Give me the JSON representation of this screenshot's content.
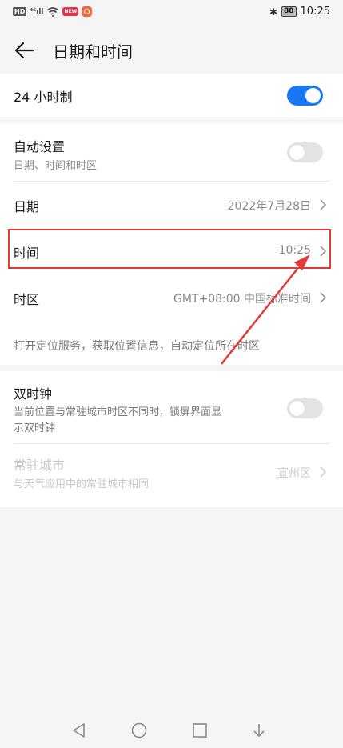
{
  "status_bar": {
    "hd": "HD",
    "signal": "⁴⁶ıll",
    "red_badge": "NEW",
    "time": "10:25",
    "battery": "88"
  },
  "header": {
    "title": "日期和时间"
  },
  "rows": {
    "hour24": {
      "label": "24 小时制",
      "enabled": true
    },
    "auto": {
      "label": "自动设置",
      "sub": "日期、时间和时区",
      "enabled": false
    },
    "date": {
      "label": "日期",
      "value": "2022年7月28日"
    },
    "time": {
      "label": "时间",
      "value": "10:25"
    },
    "zone": {
      "label": "时区",
      "value": "GMT+08:00 中国标准时间"
    },
    "zone_hint": "打开定位服务，获取位置信息，自动定位所在时区",
    "dual": {
      "label": "双时钟",
      "sub_line1": "当前位置与常驻城市时区不同时，锁屏界面显",
      "sub_line2": "示双时钟",
      "enabled": false
    },
    "home_city": {
      "label": "常驻城市",
      "sub": "与天气应用中的常驻城市相同",
      "value": "宣州区"
    }
  },
  "colors": {
    "accent": "#1877f2",
    "highlight": "#e53935"
  }
}
